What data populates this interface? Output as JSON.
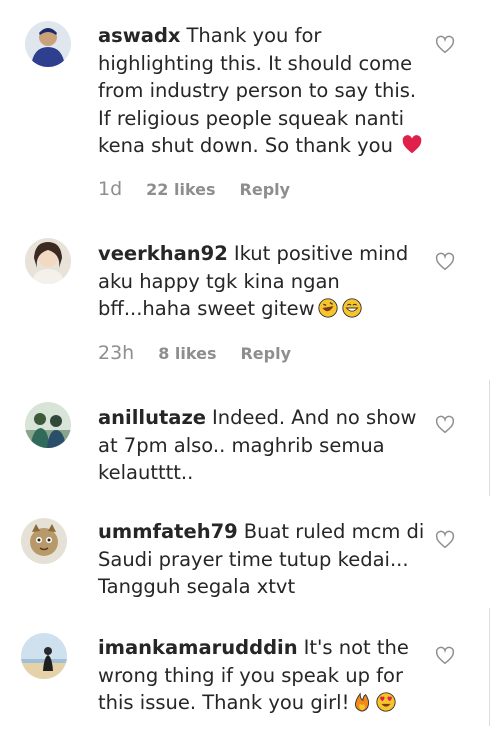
{
  "comments": [
    {
      "username": "aswadx",
      "text": "Thank you for highlighting this. It should come from industry person to say this. If religious people squeak nanti kena shut down. So thank you",
      "emoji": [
        "heart"
      ],
      "time": "1d",
      "likes": "22 likes",
      "reply": "Reply"
    },
    {
      "username": "veerkhan92",
      "text": "Ikut positive mind aku happy tgk kina ngan bff...haha sweet gitew",
      "emoji": [
        "rofl",
        "grin"
      ],
      "time": "23h",
      "likes": "8 likes",
      "reply": "Reply"
    },
    {
      "username": "anillutaze",
      "text": "Indeed. And no show at 7pm also.. maghrib semua kelautttt..",
      "emoji": []
    },
    {
      "username": "ummfateh79",
      "text": "Buat ruled mcm di Saudi prayer time tutup kedai... Tangguh segala xtvt",
      "emoji": []
    },
    {
      "username": "imankamarudddin",
      "text": "It's not the wrong thing if you speak up for this issue. Thank you girl!",
      "emoji": [
        "fire",
        "heart-eyes"
      ]
    }
  ],
  "colors": {
    "text": "#262626",
    "meta": "#8e8e8e",
    "heart_outline": "#8e8e8e",
    "emoji_red": "#e0204a",
    "emoji_yellow": "#f7c52b"
  }
}
